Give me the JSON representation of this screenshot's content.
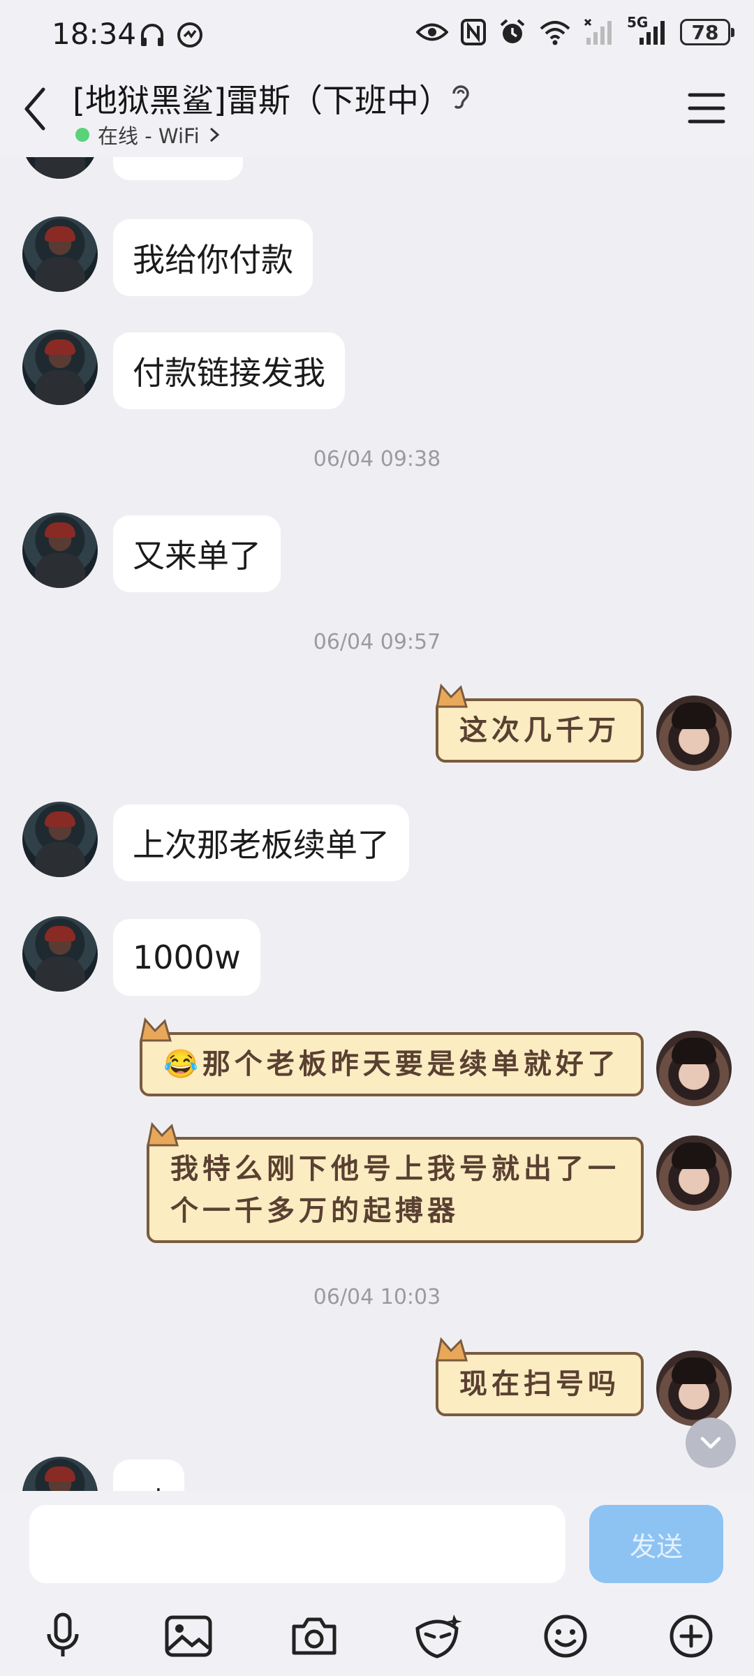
{
  "status_bar": {
    "time": "18:34",
    "network_label": "5G",
    "battery": "78",
    "icons": [
      "headphones-icon",
      "app-notification-icon",
      "eye-icon",
      "nfc-icon",
      "alarm-icon",
      "wifi-icon",
      "signal-sim2-icon",
      "signal-5g-icon",
      "battery-icon"
    ]
  },
  "header": {
    "title": "[地狱黑鲨]雷斯（下班中）",
    "presence": "在线 - WiFi",
    "presence_color": "#5ad27a"
  },
  "messages": {
    "m1": "我给你付款",
    "m2": "付款链接发我",
    "t1": "06/04 09:38",
    "m3": "又来单了",
    "t2": "06/04 09:57",
    "m4": "这次几千万",
    "m5": "上次那老板续单了",
    "m6": "1000w",
    "m7_emoji": "😂",
    "m7": "那个老板昨天要是续单就好了",
    "m8": "我特么刚下他号上我号就出了一个一千多万的起搏器",
    "t3": "06/04 10:03",
    "m9": "现在扫号吗",
    "m10": "对"
  },
  "input": {
    "placeholder": "",
    "send_label": "发送",
    "send_color": "#8dc3f3"
  },
  "toolbar": [
    "microphone-icon",
    "image-icon",
    "camera-icon",
    "mask-icon",
    "emoji-icon",
    "plus-icon"
  ]
}
